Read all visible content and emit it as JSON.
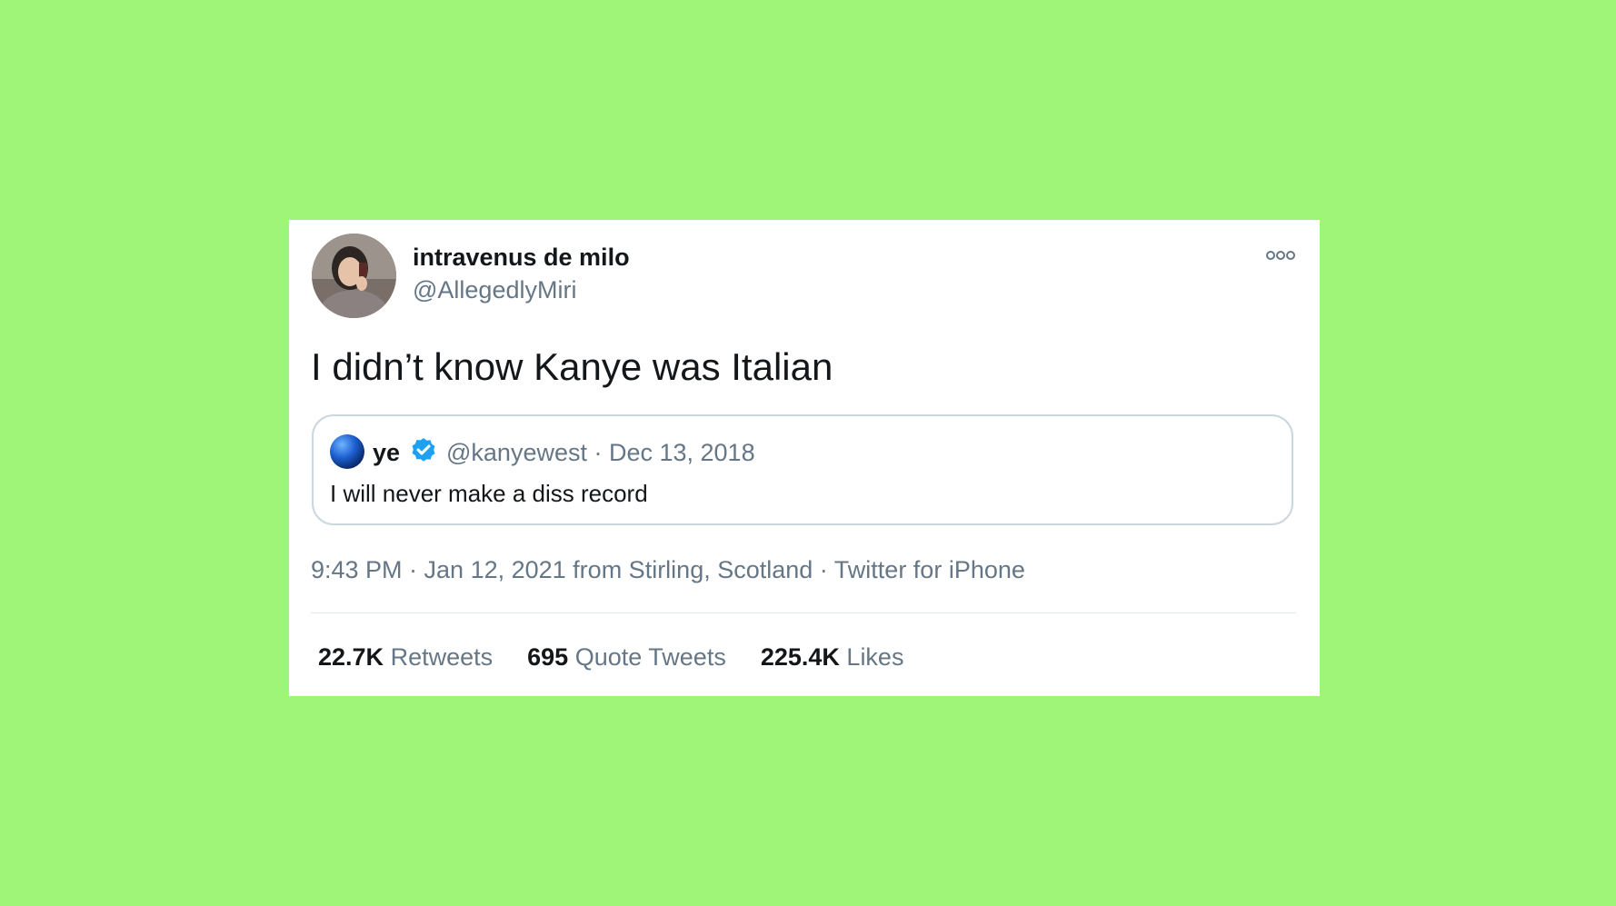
{
  "tweet": {
    "display_name": "intravenus de milo",
    "handle": "@AllegedlyMiri",
    "text": "I didn’t know Kanye was Italian",
    "more_icon": "more-dots-icon",
    "timestamp": "9:43 PM · Jan 12, 2021 from Stirling, Scotland · Twitter for iPhone",
    "stats": {
      "retweets_count": "22.7K",
      "retweets_label": "Retweets",
      "quote_tweets_count": "695",
      "quote_tweets_label": "Quote Tweets",
      "likes_count": "225.4K",
      "likes_label": "Likes"
    }
  },
  "quoted_tweet": {
    "name": "ye",
    "verified_icon": "verified-badge-icon",
    "meta": "@kanyewest · Dec 13, 2018",
    "text": "I will never make a diss record"
  },
  "colors": {
    "background": "#9ef577",
    "card": "#ffffff",
    "primary_text": "#14171a",
    "secondary_text": "#657786",
    "verified": "#1da1f2",
    "border": "#ccd6dd"
  }
}
